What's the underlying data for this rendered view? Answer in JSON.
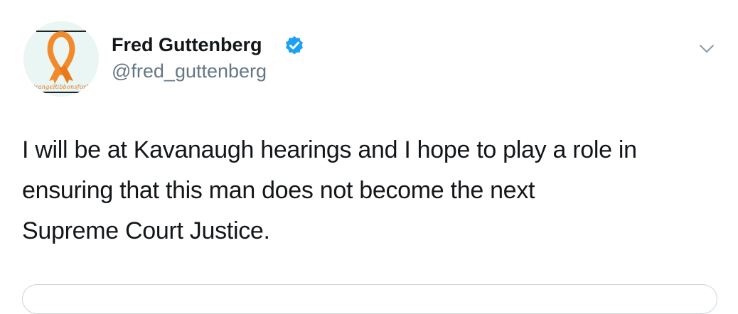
{
  "tweet": {
    "author": {
      "display_name": "Fred Guttenberg",
      "handle": "@fred_guttenberg",
      "verified": true,
      "avatar_caption": "OrangeRibbonsforJa"
    },
    "text_lines": [
      "I will be at Kavanaugh hearings and I hope to play a role in",
      "ensuring that this man does not become the next",
      "Supreme Court Justice."
    ],
    "menu_icon": "chevron-down-icon",
    "verified_icon": "verified-badge-icon"
  },
  "colors": {
    "background": "#ffffff",
    "top_strip": "#e6ecf0",
    "text_primary": "#14171a",
    "text_secondary": "#657786",
    "verified_blue": "#1da1f2",
    "ribbon_orange": "#f28a2c",
    "avatar_bg": "#eaf6f3",
    "card_border": "#ccd6dd"
  }
}
